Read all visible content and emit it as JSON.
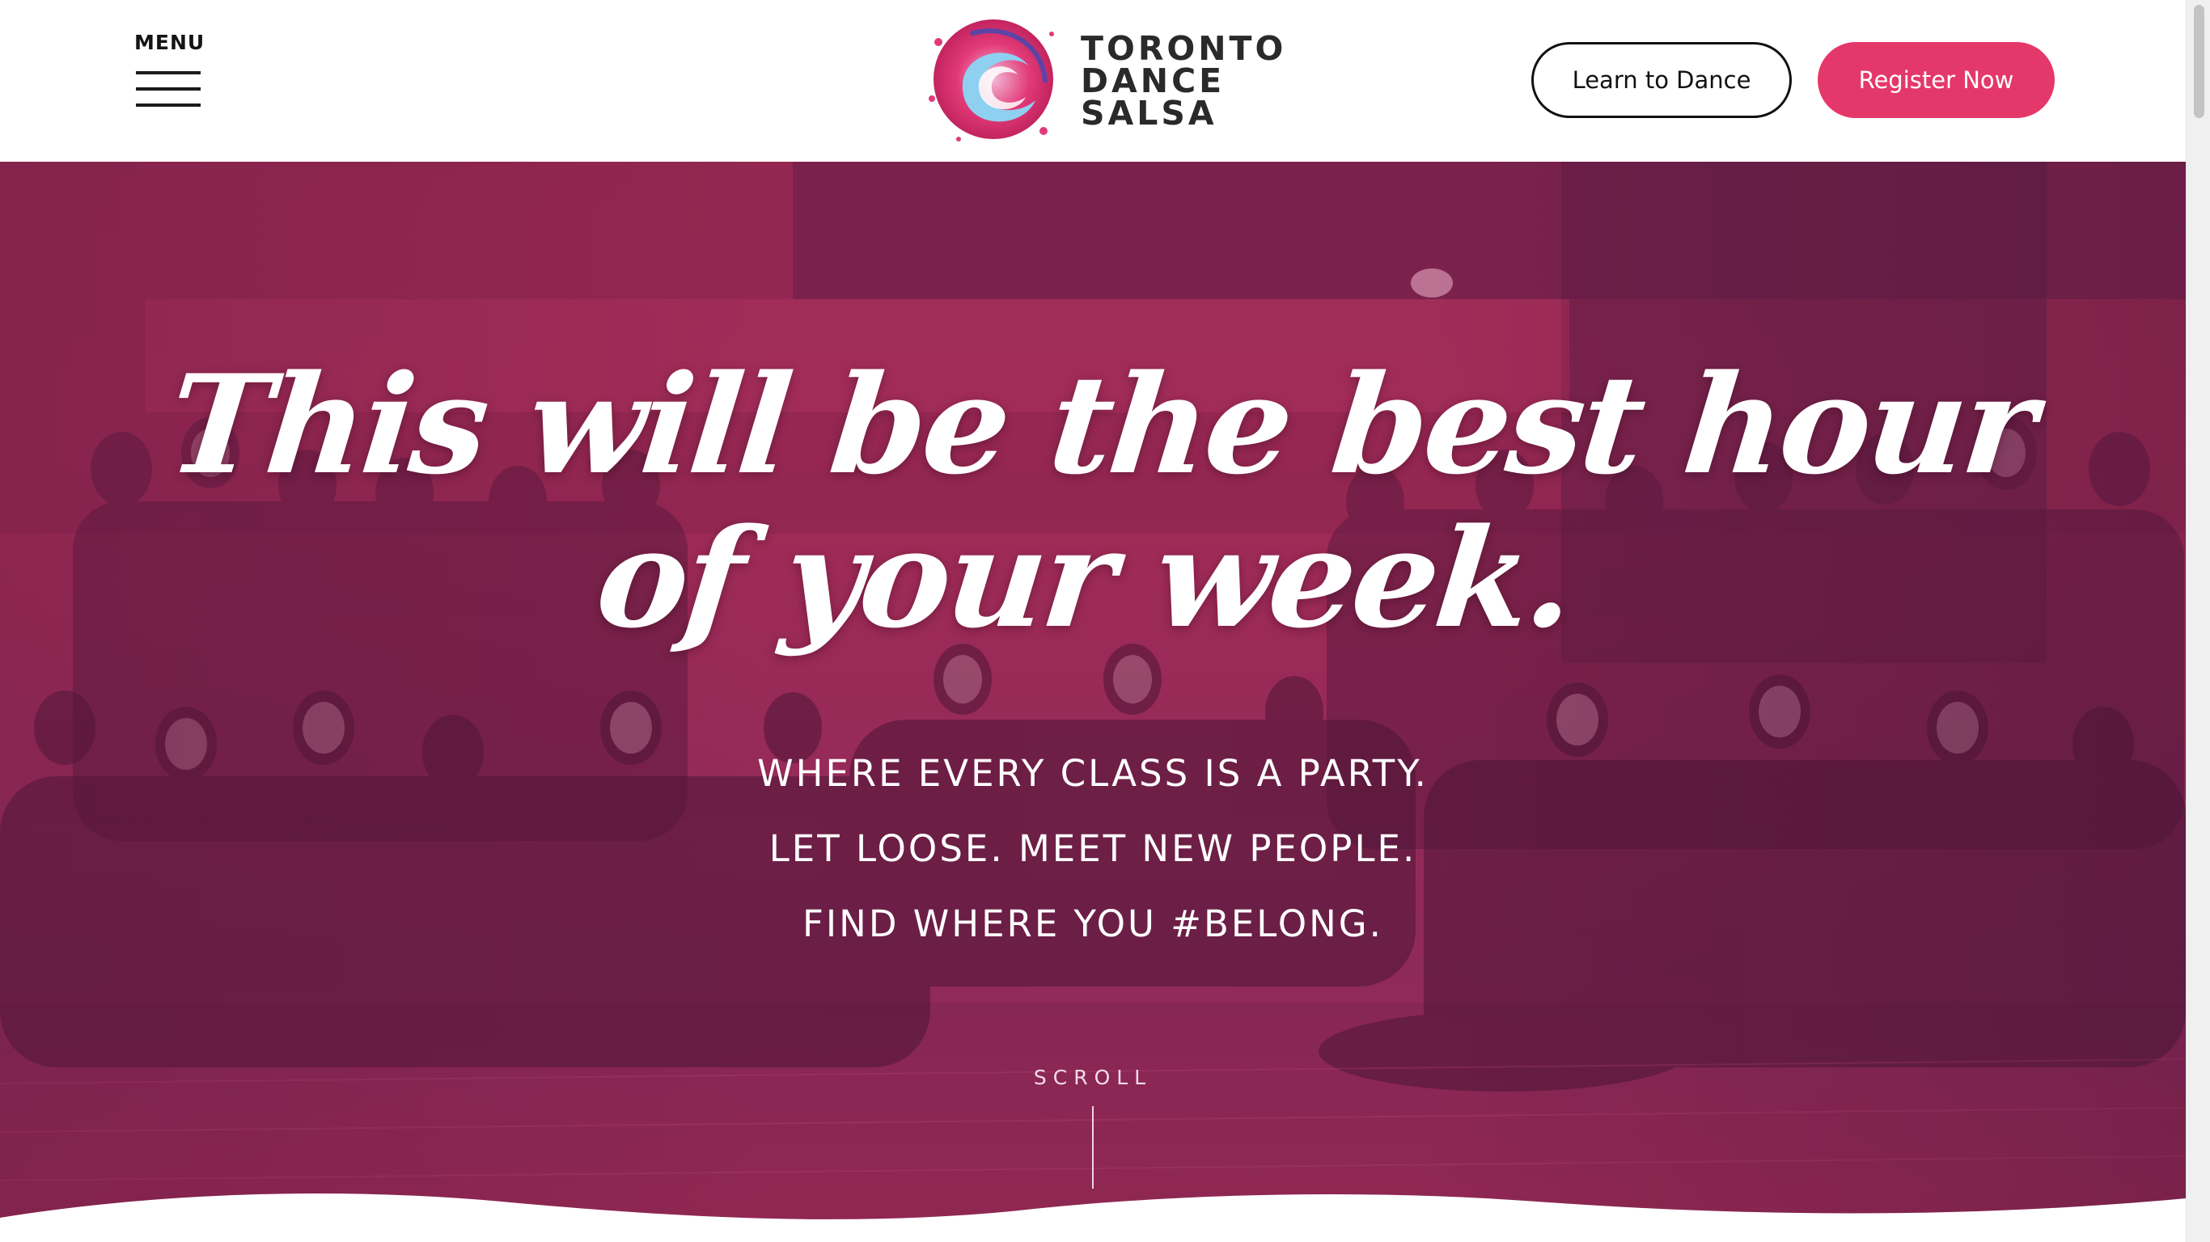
{
  "header": {
    "menu_label": "MENU",
    "logo_lines": [
      "TORONTO",
      "DANCE",
      "SALSA"
    ],
    "learn_button": "Learn to Dance",
    "register_button": "Register Now"
  },
  "hero": {
    "headline_line1": "This will be the best hour",
    "headline_line2": "of your week.",
    "tagline_1": "WHERE EVERY CLASS IS A PARTY.",
    "tagline_2": "LET LOOSE. MEET NEW PEOPLE.",
    "tagline_3": "FIND WHERE YOU #BELONG.",
    "scroll_label": "SCROLL"
  },
  "colors": {
    "accent": "#e5386a",
    "hero_tint": "#a02a56",
    "logo_pink": "#e23a78",
    "logo_blue": "#7fc9ec"
  },
  "icons": {
    "menu": "hamburger-icon",
    "logo": "splash-wave-logo"
  }
}
